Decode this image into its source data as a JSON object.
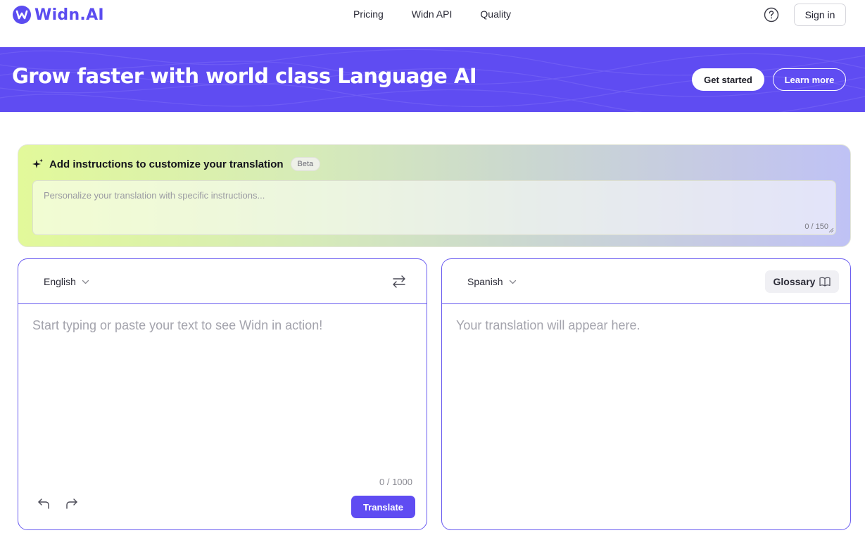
{
  "header": {
    "logo_text": "Widn.AI",
    "nav": [
      {
        "label": "Pricing"
      },
      {
        "label": "Widn API"
      },
      {
        "label": "Quality"
      }
    ],
    "help_icon": "question-circle-icon",
    "sign_in_label": "Sign in"
  },
  "banner": {
    "title": "Grow faster with world class Language AI",
    "get_started_label": "Get started",
    "learn_more_label": "Learn more",
    "background_color": "#5f4cf2"
  },
  "instructions": {
    "title": "Add instructions to customize your translation",
    "badge": "Beta",
    "placeholder": "Personalize your translation with specific instructions...",
    "value": "",
    "count": "0 / 150",
    "icon": "sparkle-icon"
  },
  "source": {
    "language": "English",
    "placeholder": "Start typing or paste your text to see Widn in action!",
    "value": "",
    "count": "0 / 1000",
    "translate_label": "Translate",
    "swap_icon": "swap-arrows-icon",
    "undo_icon": "undo-icon",
    "redo_icon": "redo-icon"
  },
  "target": {
    "language": "Spanish",
    "placeholder": "Your translation will appear here.",
    "glossary_label": "Glossary",
    "glossary_icon": "book-icon"
  },
  "colors": {
    "accent": "#5f4cf2",
    "panel_border": "#6a5cf0"
  }
}
